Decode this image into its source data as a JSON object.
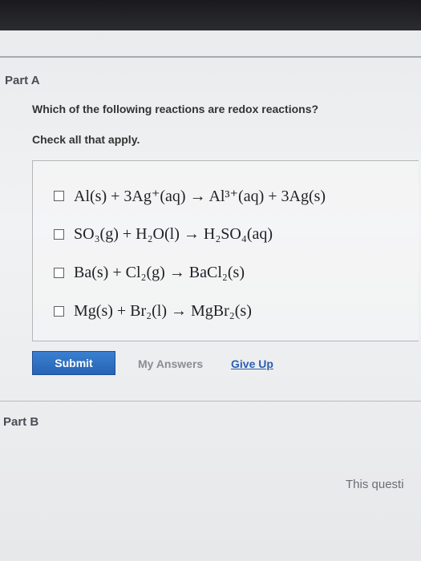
{
  "part_a": {
    "title": "Part A",
    "question": "Which of the following reactions are redox reactions?",
    "instruction": "Check all that apply.",
    "options": [
      {
        "label": "Al(s) + 3Ag⁺(aq) → Al³⁺(aq) + 3Ag(s)",
        "checked": false
      },
      {
        "label": "SO₃(g) + H₂O(l) → H₂SO₄(aq)",
        "checked": false
      },
      {
        "label": "Ba(s) + Cl₂(g) → BaCl₂(s)",
        "checked": false
      },
      {
        "label": "Mg(s) + Br₂(l) → MgBr₂(s)",
        "checked": false
      }
    ]
  },
  "actions": {
    "submit_label": "Submit",
    "my_answers_label": "My Answers",
    "give_up_label": "Give Up"
  },
  "part_b": {
    "title": "Part B",
    "clipped_text": "This questi"
  },
  "colors": {
    "submit_button": "#2f6fc2",
    "give_up_link": "#2a5fb1"
  }
}
